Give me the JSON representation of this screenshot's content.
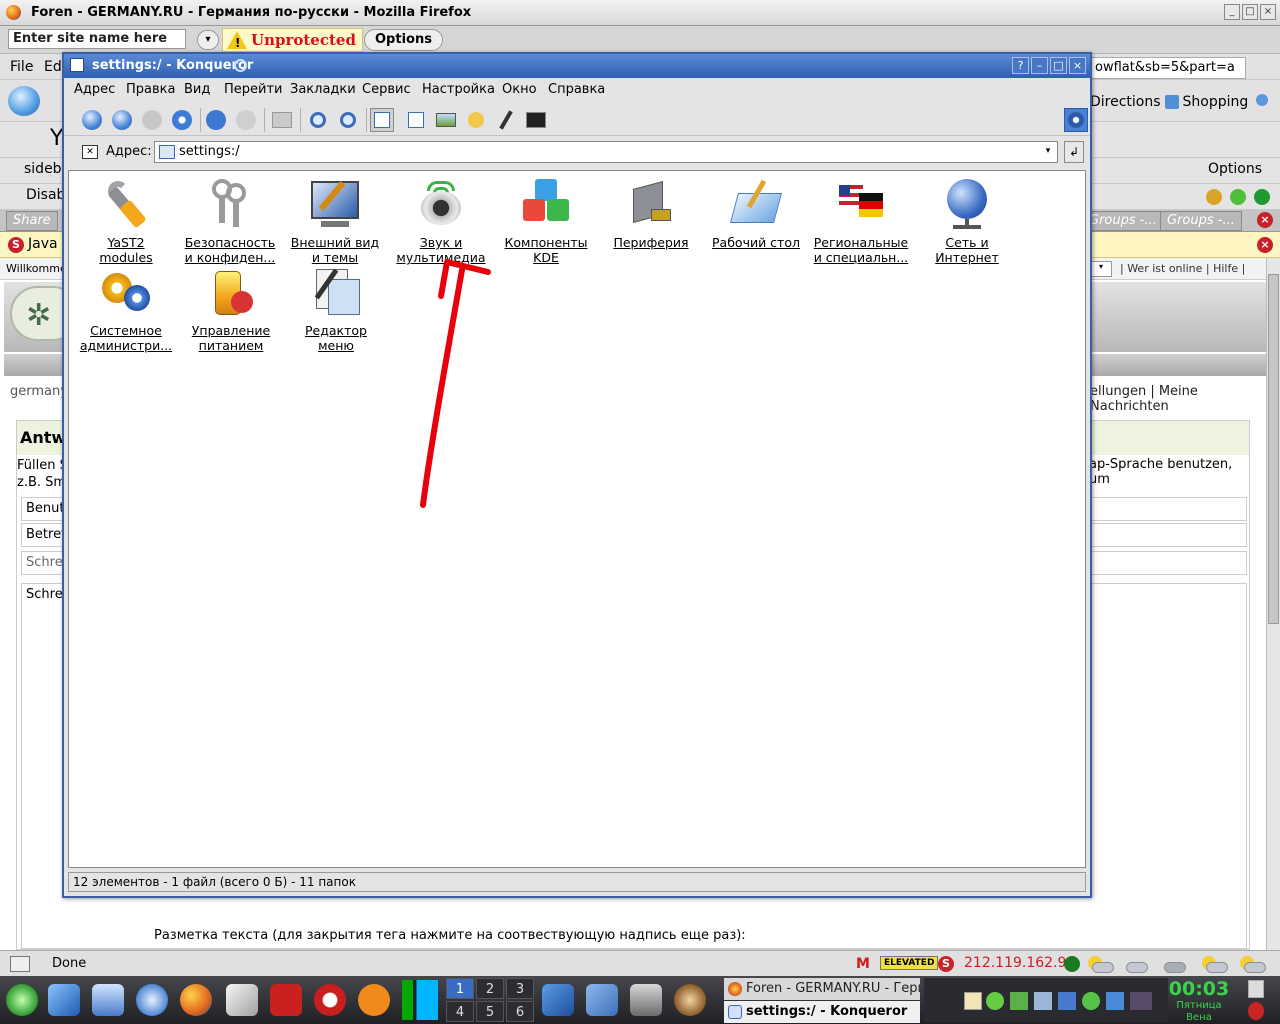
{
  "firefox": {
    "title": "Foren - GERMANY.RU - Германия по-русски - Mozilla Firefox",
    "site_name_placeholder": "Enter site name here",
    "unprotected": "Unprotected",
    "options": "Options",
    "menu_file": "File",
    "menu_edit_partial": "Ed",
    "url_partial": "owflat&sb=5&part=a",
    "directions": "Directions",
    "shopping": "Shopping",
    "bookmark_partial": "Y",
    "sidebar_partial": "sideba",
    "options_right": "Options",
    "disable_partial": "Disab",
    "share_partial": "Share",
    "groups_tab1": "Groups -...",
    "groups_tab2": "Groups -...",
    "java_partial": "Java",
    "status_done": "Done",
    "elevated": "ELEVATED",
    "ip": "212.119.162.9"
  },
  "webpage": {
    "willkommen_partial": "Willkommen",
    "top_right": "| Wer ist online | Hilfe |",
    "crumb_partial": "germany",
    "nav_right": "ellungen | Meine Nachrichten",
    "antw_partial": "Antwo",
    "fill_line1_partial": "Füllen S",
    "fill_line2_partial": "z.B. Sm",
    "fill_right": "ap-Sprache benutzen, um",
    "field_benutz": "Benutz",
    "field_betreff": "Betreff",
    "field_schrei": "Schrei",
    "field_schrei2": "Schrei",
    "markup_text": "Разметка текста (для закрытия тега нажмите на соотвествующую надпись еще раз):"
  },
  "konqueror": {
    "title": "settings:/ - Konqueror",
    "menu": [
      "Адрес",
      "Правка",
      "Вид",
      "Перейти",
      "Закладки",
      "Сервис",
      "Настройка",
      "Окно",
      "Справка"
    ],
    "address_label": "Адрес:",
    "address_value": "settings:/",
    "items": [
      {
        "line1": "YaST2",
        "line2": "modules",
        "icon": "wrench-icon"
      },
      {
        "line1": "Безопасность",
        "line2": "и конфиден...",
        "icon": "keys-icon"
      },
      {
        "line1": "Внешний вид",
        "line2": "и темы",
        "icon": "monitor-brush-icon"
      },
      {
        "line1": "Звук и",
        "line2": "мультимедиа",
        "icon": "speaker-icon"
      },
      {
        "line1": "Компоненты",
        "line2": "KDE",
        "icon": "cubes-icon"
      },
      {
        "line1": "Периферия",
        "line2": "",
        "icon": "device-icon"
      },
      {
        "line1": "Рабочий стол",
        "line2": "",
        "icon": "desktop-icon"
      },
      {
        "line1": "Региональные",
        "line2": "и специальн...",
        "icon": "flags-icon"
      },
      {
        "line1": "Сеть и",
        "line2": "Интернет",
        "icon": "globe-icon"
      },
      {
        "line1": "Системное",
        "line2": "администри...",
        "icon": "gears-icon"
      },
      {
        "line1": "Управление",
        "line2": "питанием",
        "icon": "battery-icon"
      },
      {
        "line1": "Редактор",
        "line2": "меню",
        "icon": "menu-editor-icon"
      }
    ],
    "status": "12 элементов - 1 файл (всего 0 Б) - 11 папок",
    "annotation_arrow_color": "#e8000b"
  },
  "taskbar": {
    "pager": [
      "1",
      "2",
      "3",
      "4",
      "5",
      "6"
    ],
    "active_desktop": "1",
    "task1": "Foren - GERMANY.RU - Герм",
    "task2": "settings:/ - Konqueror",
    "clock_time": "00:03",
    "clock_day": "Пятница",
    "clock_city": "Вена"
  }
}
